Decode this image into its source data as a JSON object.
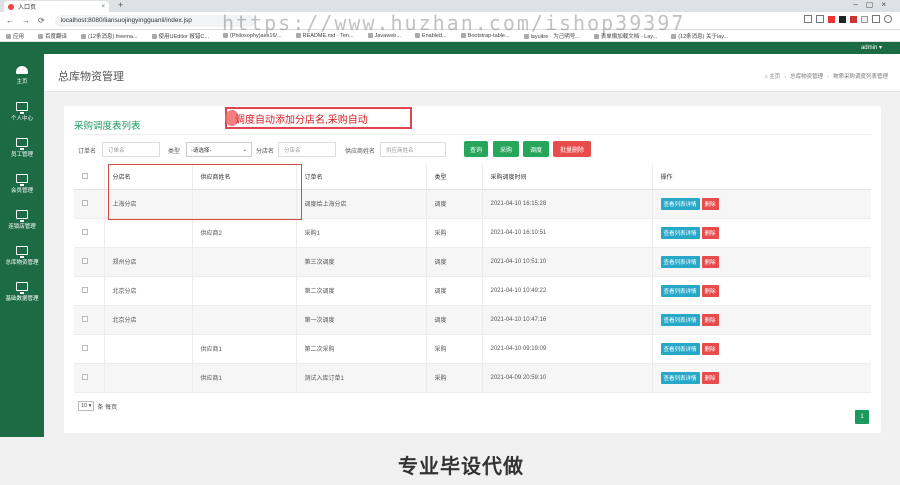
{
  "browser": {
    "tab_title": "入口页",
    "new_tab": "+",
    "url": "localhost:8080/liansuojingyingguanli/index.jsp",
    "watermark": "https://www.huzhan.com/ishop39397",
    "bookmarks": [
      "应用",
      "百度翻译",
      "(12条消息) freema...",
      "使用UEditor 报错C...",
      "(Philosophy)aes16/...",
      "README.md · Ten...",
      "Javaweb...",
      "Enabled...",
      "Bootstrap-table...",
      "layuitre · 为己明号...",
      "表单懒加载文档 - Lay...",
      "(12条消息) 关于lay..."
    ]
  },
  "app": {
    "user": "admin ▾",
    "sidebar": [
      {
        "label": "主页",
        "icon": "dashboard-icon"
      },
      {
        "label": "个人中心",
        "icon": "monitor-icon"
      },
      {
        "label": "员工管理",
        "icon": "monitor-icon"
      },
      {
        "label": "会员管理",
        "icon": "monitor-icon"
      },
      {
        "label": "连锁店管理",
        "icon": "monitor-icon"
      },
      {
        "label": "总库物资管理",
        "icon": "monitor-icon"
      },
      {
        "label": "基础数据管理",
        "icon": "monitor-icon"
      }
    ],
    "page_title": "总库物资管理",
    "breadcrumb": [
      "主页",
      "总库物资管理",
      "物质采购调度列表管理"
    ],
    "panel_title": "采购调度表列表",
    "annotation": "调度自动添加分店名,采购自动",
    "filters": {
      "order_label": "订单名",
      "order_placeholder": "订单名",
      "type_label": "类型",
      "type_value": "-请选择-",
      "shop_label": "分店名",
      "shop_placeholder": "分店名",
      "supplier_label": "供应商姓名",
      "supplier_placeholder": "供应商姓名"
    },
    "buttons": {
      "query": "查询",
      "purchase": "采购",
      "dispatch": "调度",
      "batch_delete": "批量删除"
    },
    "columns": [
      "分店名",
      "供应商姓名",
      "订单名",
      "类型",
      "采购调度时间",
      "操作"
    ],
    "rows": [
      {
        "shop": "上海分店",
        "supplier": "",
        "order": "调度给上海分店",
        "type": "调度",
        "time": "2021-04-10 16:15:28"
      },
      {
        "shop": "",
        "supplier": "供应商2",
        "order": "采购1",
        "type": "采购",
        "time": "2021-04-10 16:10:51"
      },
      {
        "shop": "郑州分店",
        "supplier": "",
        "order": "第三次调度",
        "type": "调度",
        "time": "2021-04-10 10:51:10"
      },
      {
        "shop": "北京分店",
        "supplier": "",
        "order": "第二次调度",
        "type": "调度",
        "time": "2021-04-10 10:49:22"
      },
      {
        "shop": "北京分店",
        "supplier": "",
        "order": "第一次调度",
        "type": "调度",
        "time": "2021-04-10 10:47:16"
      },
      {
        "shop": "",
        "supplier": "供应商1",
        "order": "第二次采购",
        "type": "采购",
        "time": "2021-04-10 09:19:09"
      },
      {
        "shop": "",
        "supplier": "供应商1",
        "order": "测试入库订单1",
        "type": "采购",
        "time": "2021-04-09 20:59:10"
      }
    ],
    "row_actions": {
      "view": "查看列表详情",
      "delete": "删除"
    },
    "pager": {
      "size": "10 ▾",
      "suffix": "条 每页",
      "page": "1"
    }
  },
  "banner": "专业毕设代做"
}
